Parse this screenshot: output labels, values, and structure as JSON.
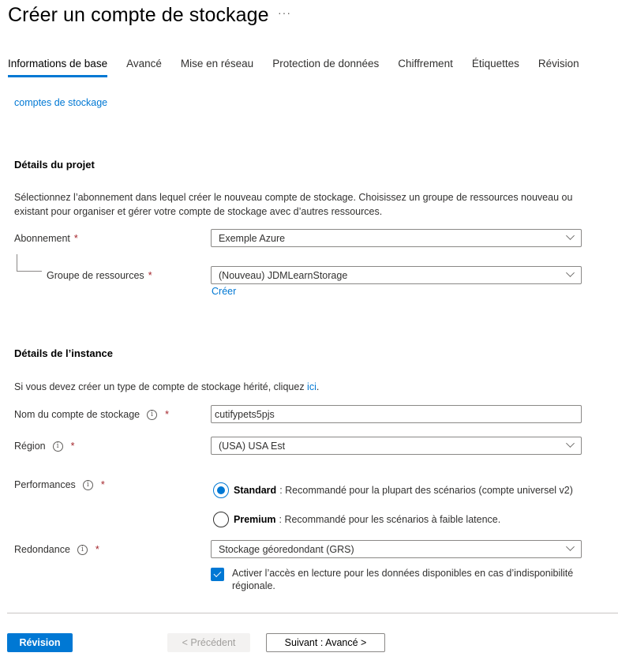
{
  "header": {
    "title": "Créer un compte de stockage",
    "more_label": "···"
  },
  "tabs": [
    {
      "label": "Informations de base",
      "active": true
    },
    {
      "label": "Avancé"
    },
    {
      "label": "Mise en réseau"
    },
    {
      "label": "Protection de données"
    },
    {
      "label": "Chiffrement"
    },
    {
      "label": "Étiquettes"
    },
    {
      "label": "Révision"
    }
  ],
  "top_link": "comptes de stockage",
  "project": {
    "title": "Détails du projet",
    "description": "Sélectionnez l’abonnement dans lequel créer le nouveau compte de stockage. Choisissez un groupe de ressources nouveau ou existant pour organiser et gérer votre compte de stockage avec d’autres ressources.",
    "subscription": {
      "label": "Abonnement",
      "required": "*",
      "value": "Exemple Azure"
    },
    "resource_group": {
      "label": "Groupe de ressources",
      "required": "*",
      "value": "(Nouveau) JDMLearnStorage",
      "create_link": "Créer"
    }
  },
  "instance": {
    "title": "Détails de l’instance",
    "legacy_text": "Si vous devez créer un type de compte de stockage hérité, cliquez ",
    "legacy_link": "ici",
    "legacy_suffix": ".",
    "name": {
      "label": "Nom du compte de stockage",
      "required": "*",
      "value": "cutifypets5pjs"
    },
    "region": {
      "label": "Région",
      "required": "*",
      "value": "(USA) USA Est"
    },
    "performance": {
      "label": "Performances",
      "required": "*",
      "options": [
        {
          "name": "Standard",
          "desc": ": Recommandé pour la plupart des scénarios (compte universel v2)",
          "checked": true
        },
        {
          "name": "Premium",
          "desc": ": Recommandé pour les scénarios à faible latence.",
          "checked": false
        }
      ]
    },
    "redundancy": {
      "label": "Redondance",
      "required": "*",
      "value": "Stockage géoredondant (GRS)",
      "checkbox_label": "Activer l’accès en lecture pour les données disponibles en cas d’indisponibilité régionale.",
      "checkbox_checked": true
    }
  },
  "footer": {
    "review": "Révision",
    "previous": "< Précédent",
    "next": "Suivant : Avancé >"
  },
  "icons": {
    "info": "i"
  }
}
